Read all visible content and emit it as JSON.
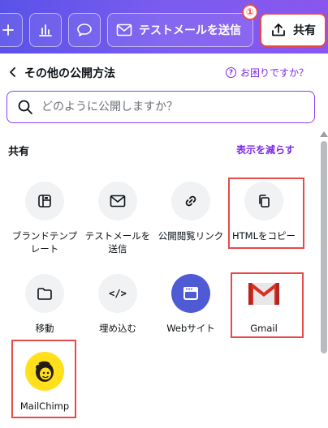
{
  "toolbar": {
    "email_label": "テストメールを送信",
    "share_label": "共有",
    "step_number": "①",
    "accent": "#7a5cef"
  },
  "panel": {
    "title": "その他の公開方法",
    "help_label": "お困りですか？",
    "help_glyph": "?"
  },
  "search": {
    "placeholder": "どのように公開しますか？"
  },
  "section": {
    "title": "共有",
    "show_less": "表示を減らす"
  },
  "tiles": [
    {
      "label": "ブランドテンプレート",
      "icon": "brand-template-icon"
    },
    {
      "label": "テストメールを送信",
      "icon": "envelope-icon"
    },
    {
      "label": "公開閲覧リンク",
      "icon": "link-icon"
    },
    {
      "label": "HTMLをコピー",
      "icon": "copy-icon"
    },
    {
      "label": "移動",
      "icon": "folder-icon"
    },
    {
      "label": "埋め込む",
      "icon": "embed-icon",
      "glyph": "</>"
    },
    {
      "label": "Webサイト",
      "icon": "website-icon"
    },
    {
      "label": "Gmail",
      "icon": "gmail-logo"
    },
    {
      "label": "MailChimp",
      "icon": "mailchimp-logo"
    }
  ],
  "colors": {
    "highlight": "#e84a4a",
    "link_purple": "#7d2ae8"
  }
}
